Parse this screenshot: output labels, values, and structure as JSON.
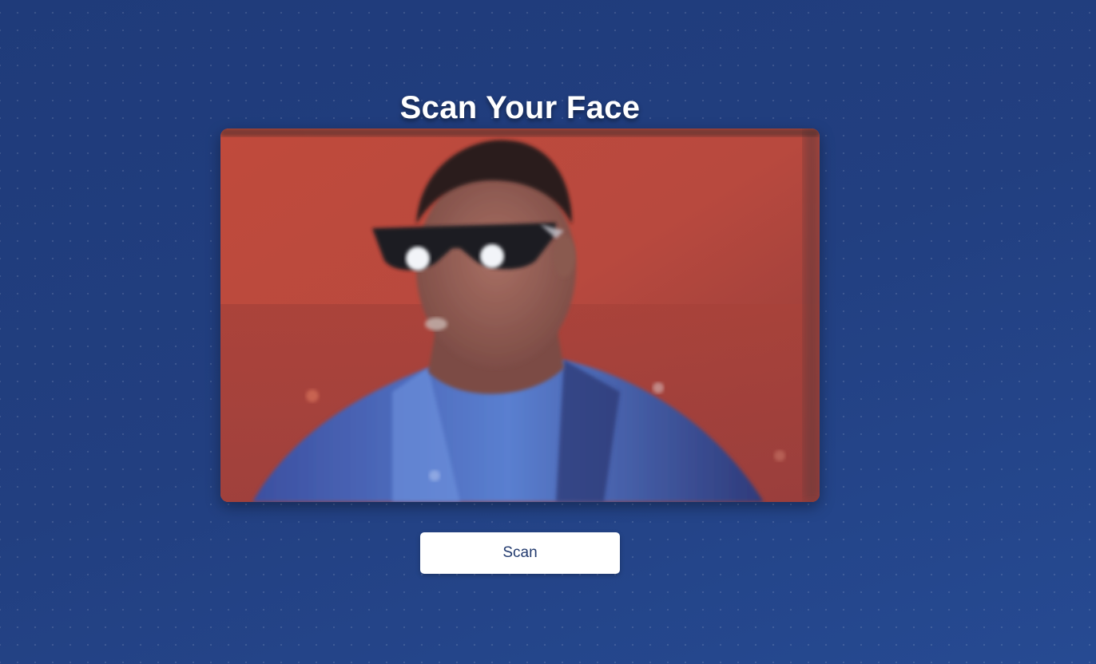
{
  "page": {
    "title": "Scan Your Face"
  },
  "camera": {
    "feed_subject": "person-with-sunglasses",
    "background_color": "#b9473d",
    "shirt_color": "#3a5fb8"
  },
  "actions": {
    "scan_label": "Scan"
  },
  "colors": {
    "page_background": "#223f80",
    "title_text": "#ffffff",
    "button_background": "#ffffff",
    "button_text": "#223a6e"
  }
}
